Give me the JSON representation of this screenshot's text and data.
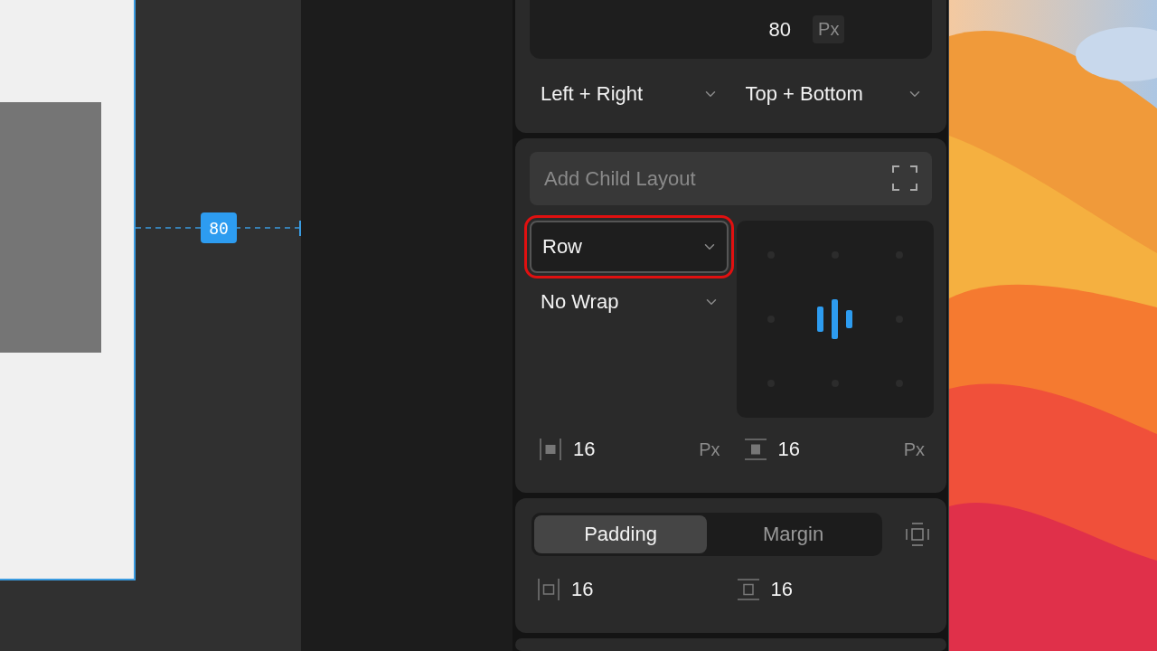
{
  "canvas": {
    "measure": "80"
  },
  "size_section": {
    "value": "80",
    "unit": "Px",
    "dropdowns": [
      {
        "label": "Left + Right"
      },
      {
        "label": "Top + Bottom"
      }
    ]
  },
  "layout_section": {
    "child_layout": {
      "placeholder": "Add Child Layout"
    },
    "direction": {
      "value": "Row",
      "highlighted": true
    },
    "wrap": {
      "value": "No Wrap",
      "highlighted": false
    },
    "gaps": [
      {
        "kind": "horizontal",
        "value": "16",
        "unit": "Px"
      },
      {
        "kind": "vertical",
        "value": "16",
        "unit": "Px"
      }
    ]
  },
  "spacing_section": {
    "tabs": [
      {
        "label": "Padding",
        "selected": true
      },
      {
        "label": "Margin",
        "selected": false
      }
    ],
    "values": [
      {
        "kind": "horizontal",
        "value": "16"
      },
      {
        "kind": "vertical",
        "value": "16"
      }
    ]
  }
}
